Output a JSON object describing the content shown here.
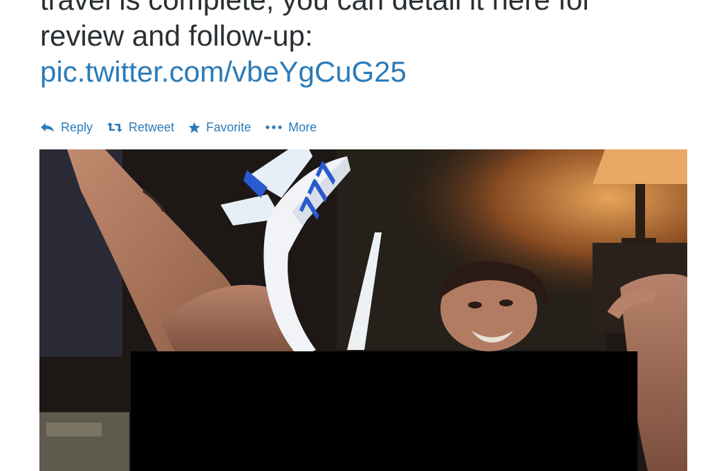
{
  "tweet": {
    "text_lines": [
      "travel is complete, you can detail it here for",
      "review and follow-up:"
    ],
    "link": "pic.twitter.com/vbeYgCuG25",
    "colors": {
      "text": "#292f33",
      "link": "#2b7bb9"
    }
  },
  "actions": [
    {
      "label": "Reply",
      "icon": "reply-icon"
    },
    {
      "label": "Retweet",
      "icon": "retweet-icon"
    },
    {
      "label": "Favorite",
      "icon": "star-icon"
    },
    {
      "label": "More",
      "icon": "more-dots-icon"
    }
  ],
  "media": {
    "airplane_tail_marking": "777",
    "censor_color": "#000000"
  }
}
